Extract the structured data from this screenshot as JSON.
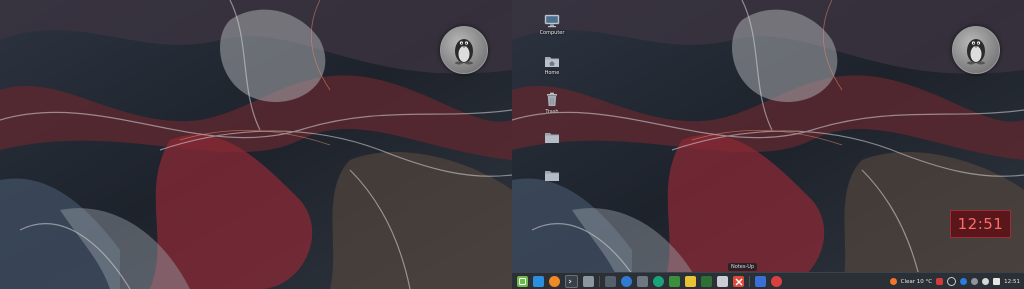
{
  "colors": {
    "taskbar_bg": "#2b3036",
    "clock_text": "#ff6b6b",
    "clock_bg": "#5f0c12",
    "folder_icon": "#9aa3ad"
  },
  "desktop": {
    "icons": [
      {
        "label": "Computer",
        "icon": "monitor-icon"
      },
      {
        "label": "Home",
        "icon": "home-folder-icon"
      },
      {
        "label": "Trash",
        "icon": "trash-icon"
      },
      {
        "label": "",
        "icon": "folder-icon"
      },
      {
        "label": "",
        "icon": "folder-icon"
      }
    ]
  },
  "clock_widget": {
    "time": "12:51"
  },
  "taskbar": {
    "tooltip": "Notes-Up",
    "weather": "Clear 10 °C",
    "time": "12:51"
  }
}
